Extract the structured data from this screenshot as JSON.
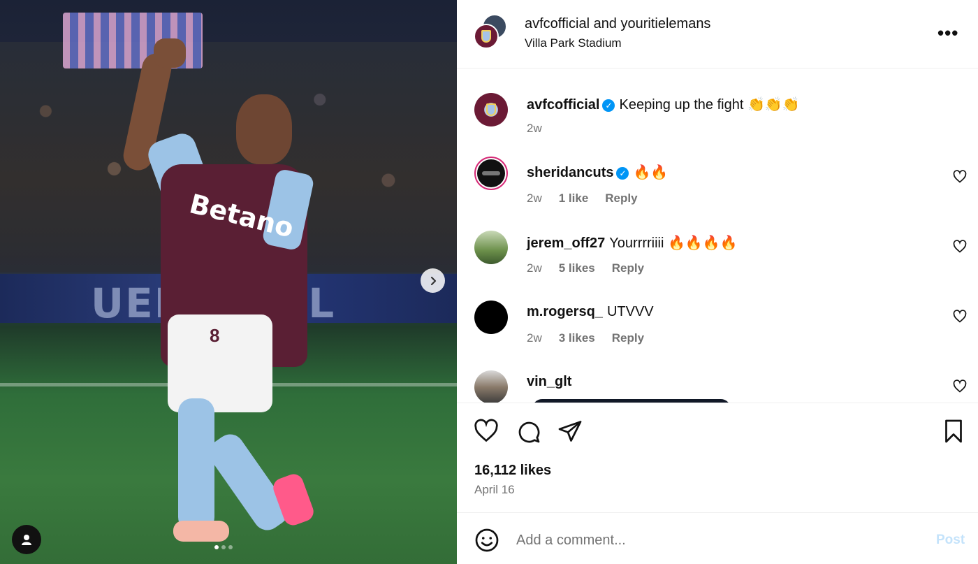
{
  "post": {
    "authors": "avfcofficial and youritielemans",
    "location": "Villa Park Stadium",
    "likes": "16,112 likes",
    "date": "April 16"
  },
  "media": {
    "board_text": "UEFA  NS L",
    "shirt_sponsor": "Betano",
    "shirt_number": "8",
    "carousel": {
      "count": 3,
      "active": 1
    },
    "player_color": "#5a1f34",
    "accent_color": "#9cc3e6"
  },
  "caption": {
    "user": "avfcofficial",
    "text": "Keeping up the fight 👏👏👏",
    "time": "2w"
  },
  "comments": [
    {
      "user": "sheridancuts",
      "text": "🔥🔥",
      "time": "2w",
      "likes": "1 like",
      "reply": "Reply"
    },
    {
      "user": "jerem_off27",
      "text": "Yourrrriiii 🔥🔥🔥🔥",
      "time": "2w",
      "likes": "5 likes",
      "reply": "Reply"
    },
    {
      "user": "m.rogersq_",
      "text": "UTVVV",
      "time": "2w",
      "likes": "3 likes",
      "reply": "Reply"
    },
    {
      "user": "vin_glt",
      "text": ""
    }
  ],
  "add_comment": {
    "placeholder": "Add a comment...",
    "post_label": "Post"
  },
  "colors": {
    "verified": "#0095f6",
    "muted": "#737373",
    "post_disabled": "#c4e3fb"
  }
}
